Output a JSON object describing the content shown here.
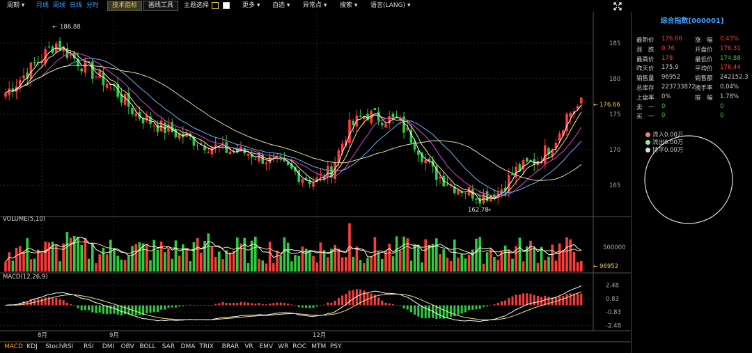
{
  "toolbar": {
    "period_menu": "周期",
    "periods": [
      "月线",
      "周线",
      "日线",
      "分时"
    ],
    "indicator_button": "技术指标",
    "drawing_button": "画线工具",
    "theme_label": "主题选择",
    "menus": [
      "更多",
      "自选",
      "异常点",
      "搜索",
      "语言(LANG)"
    ],
    "icons": {
      "dropdown": "chevron-down-icon",
      "fullscreen": "fullscreen-icon"
    }
  },
  "chart": {
    "title_volume": "VOLUME(5,10)",
    "title_macd": "MACD(12,26,9)",
    "colors": {
      "up": "#ff3b3b",
      "down": "#2ecc40",
      "ma5": "#ffffff",
      "ma10": "#f0e68c",
      "ma20": "#e040e0",
      "ma30": "#6ab4f0",
      "ma60": "#d8e0a0",
      "accent": "#e8d44a"
    },
    "max_label": "186.88",
    "min_label": "162.78",
    "last_price_label": "176.66",
    "last_volume_label": "96952",
    "x_labels": [
      "8月",
      "9月",
      "12月"
    ]
  },
  "chart_data": [
    {
      "type": "candlestick",
      "title": "",
      "ylim": [
        161,
        189
      ],
      "yticks": [
        165,
        170,
        175,
        180,
        185
      ],
      "xlabels": [
        "8月",
        "9月",
        "12月"
      ],
      "max": 186.88,
      "min": 162.78,
      "last": 176.66
    },
    {
      "type": "bar",
      "title": "VOLUME(5,10)",
      "yticks": [
        500000
      ],
      "last": 96952
    },
    {
      "type": "bar",
      "title": "MACD(12,26,9)",
      "yticks": [
        2.48,
        0.83,
        -0.83,
        -2.48
      ]
    }
  ],
  "quote": {
    "title": "综合指数[000001]",
    "rows": [
      [
        {
          "l": "最新价",
          "v": "176.66",
          "c": "red"
        },
        {
          "l": "涨　幅",
          "v": "0.43%",
          "c": "red"
        }
      ],
      [
        {
          "l": "涨　跌",
          "v": "0.76",
          "c": "red"
        },
        {
          "l": "开盘价",
          "v": "176.31",
          "c": "red"
        }
      ],
      [
        {
          "l": "最高价",
          "v": "178",
          "c": "red"
        },
        {
          "l": "最低价",
          "v": "174.88",
          "c": "green"
        }
      ],
      [
        {
          "l": "昨天价",
          "v": "175.9",
          "c": "gray"
        },
        {
          "l": "平均价",
          "v": "176.44",
          "c": "red"
        }
      ],
      [
        {
          "l": "销售量",
          "v": "96952",
          "c": "gray"
        },
        {
          "l": "销售额",
          "v": "242152.3",
          "c": "gray"
        }
      ],
      [
        {
          "l": "总库存",
          "v": "223733872",
          "c": "gray"
        },
        {
          "l": "换手率",
          "v": "0.04%",
          "c": "gray"
        }
      ],
      [
        {
          "l": "上盘率",
          "v": "0%",
          "c": "gray"
        },
        {
          "l": "振　幅",
          "v": "1.78%",
          "c": "gray"
        }
      ],
      [
        {
          "l": "卖　一",
          "v": "0",
          "c": "green"
        },
        {
          "l": "",
          "v": "0",
          "c": "green"
        }
      ],
      [
        {
          "l": "买　一",
          "v": "0",
          "c": "green"
        },
        {
          "l": "",
          "v": "0",
          "c": "green"
        }
      ]
    ],
    "flows": [
      {
        "label": "流入0.00万",
        "color": "#f08080"
      },
      {
        "label": "流出0.00万",
        "color": "#90ee90"
      },
      {
        "label": "持平0.00万",
        "color": "#dddddd"
      }
    ]
  },
  "tabs": [
    "MACD",
    "KDJ",
    "StochRSI",
    "RSI",
    "DMI",
    "OBV",
    "BOLL",
    "SAR",
    "DMA",
    "TRIX",
    "BRAR",
    "VR",
    "EMV",
    "WR",
    "ROC",
    "MTM",
    "PSY"
  ],
  "active_tab": "MACD"
}
